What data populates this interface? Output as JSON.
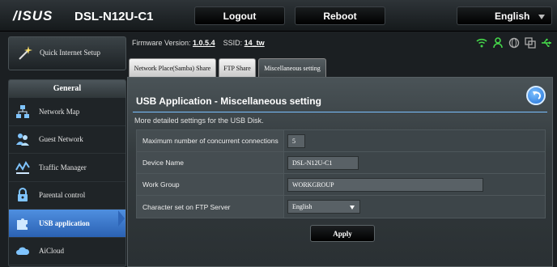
{
  "header": {
    "brand": "/ISUS",
    "model": "DSL-N12U-C1",
    "logout_label": "Logout",
    "reboot_label": "Reboot",
    "language": "English"
  },
  "status": {
    "firmware_label": "Firmware Version:",
    "firmware_value": "1.0.5.4",
    "ssid_label": "SSID:",
    "ssid_value": "14_tw",
    "icons": [
      "wifi-icon",
      "user-icon",
      "globe-icon",
      "copy-icon",
      "usb-icon"
    ]
  },
  "sidebar": {
    "quick_setup": "Quick Internet Setup",
    "section_title": "General",
    "items": [
      {
        "label": "Network Map",
        "icon": "network-map-icon"
      },
      {
        "label": "Guest Network",
        "icon": "guest-network-icon"
      },
      {
        "label": "Traffic Manager",
        "icon": "traffic-manager-icon"
      },
      {
        "label": "Parental control",
        "icon": "lock-icon"
      },
      {
        "label": "USB application",
        "icon": "puzzle-icon",
        "active": true
      },
      {
        "label": "AiCloud",
        "icon": "cloud-icon"
      }
    ]
  },
  "tabs": [
    {
      "label": "Network Place(Samba) Share"
    },
    {
      "label": "FTP Share"
    },
    {
      "label": "Miscellaneous setting",
      "active": true
    }
  ],
  "panel": {
    "title": "USB Application - Miscellaneous setting",
    "description": "More detailed settings for the USB Disk.",
    "fields": [
      {
        "label": "Maximum number of concurrent connections",
        "value": "5"
      },
      {
        "label": "Device Name",
        "value": "DSL-N12U-C1"
      },
      {
        "label": "Work Group",
        "value": "WORKGROUP"
      },
      {
        "label": "Character set on FTP Server",
        "value": "English"
      }
    ],
    "apply_label": "Apply"
  },
  "colors": {
    "accent": "#2f66b8",
    "panel_bg": "#3a4245",
    "wifi": "#45d64a",
    "usb": "#45d64a"
  }
}
